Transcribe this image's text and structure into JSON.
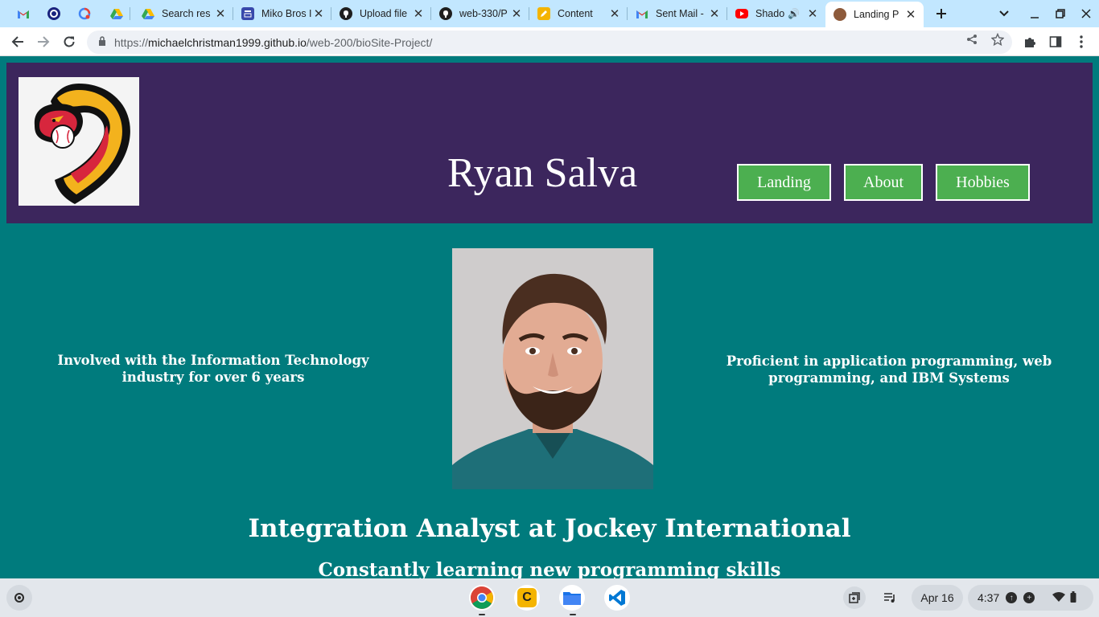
{
  "browser": {
    "tabs": [
      {
        "title": "",
        "icon": "gmail-icon",
        "pinned": true
      },
      {
        "title": "",
        "icon": "circle-app-icon",
        "pinned": true
      },
      {
        "title": "",
        "icon": "google-lens-icon",
        "pinned": true
      },
      {
        "title": "",
        "icon": "google-drive-icon",
        "pinned": true
      },
      {
        "title": "Search res",
        "icon": "google-drive-icon"
      },
      {
        "title": "Miko Bros I",
        "icon": "forms-icon"
      },
      {
        "title": "Upload file",
        "icon": "github-icon"
      },
      {
        "title": "web-330/P",
        "icon": "github-icon"
      },
      {
        "title": "Content",
        "icon": "pencil-icon"
      },
      {
        "title": "Sent Mail -",
        "icon": "gmail-icon"
      },
      {
        "title": "Shado",
        "icon": "youtube-icon",
        "audio": true
      },
      {
        "title": "Landing P",
        "icon": "cookie-icon",
        "active": true
      }
    ],
    "url_host": "michaelchristman1999.github.io",
    "url_path": "/web-200/bioSite-Project/",
    "url_scheme": "https://"
  },
  "page": {
    "title": "Ryan Salva",
    "nav": [
      {
        "label": "Landing"
      },
      {
        "label": "About"
      },
      {
        "label": "Hobbies"
      }
    ],
    "left_text": "Involved with the Information Technology industry for over 6 years",
    "right_text": "Proficient in application programming, web programming, and IBM Systems",
    "job_title": "Integration Analyst at Jockey International",
    "subheading": "Constantly learning new programming skills"
  },
  "shelf": {
    "apps": [
      "chrome-icon",
      "c-app-icon",
      "files-icon",
      "vscode-icon"
    ],
    "date": "Apr 16",
    "time": "4:37"
  },
  "colors": {
    "header_bg": "#3c265d",
    "page_bg": "#007b7d",
    "nav_button_bg": "#4caf50",
    "tabbar_bg": "#c2e7ff"
  }
}
